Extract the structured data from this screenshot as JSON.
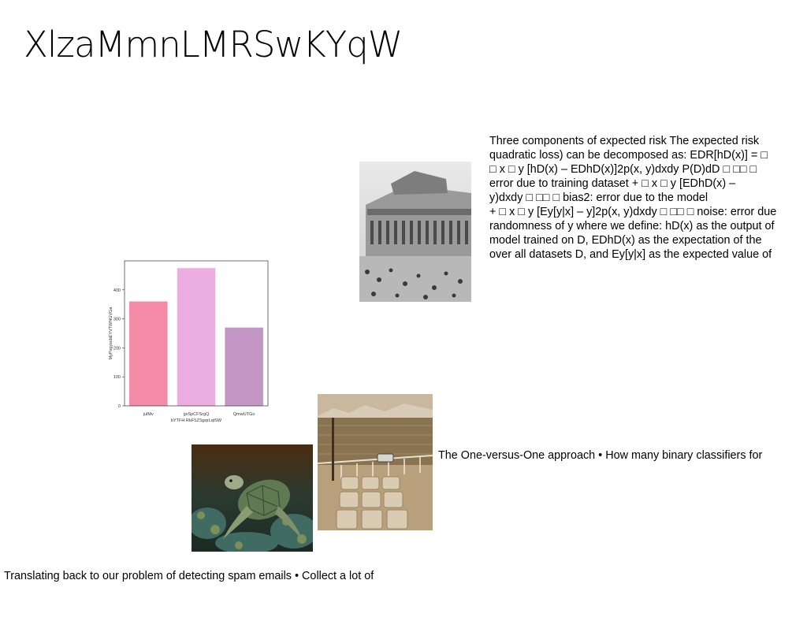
{
  "slide": {
    "title": "XlzaMmnLMRSwKYqW",
    "paragraph_lines": [
      "Three components of expected risk The expected risk",
      "quadratic loss) can be decomposed as: EDR[hD(x)] = □",
      "□ x □ y [hD(x) – EDhD(x)]2p(x, y)dxdy P(D)dD □ □□ □",
      "error due to training dataset + □ x □ y [EDhD(x) –",
      "y)dxdy □ □□ □ bias2: error due to the model",
      "+ □ x □ y [Ey[y|x] – y]2p(x, y)dxdy □ □□ □ noise: error due",
      "randomness of y where we define: hD(x) as the output of",
      "model trained on D, EDhD(x) as the expectation of the",
      "over all datasets D, and Ey[y|x] as the expected value of"
    ],
    "caption_1": "The One-versus-One approach • How many binary classifiers for",
    "caption_2": "Translating back to our problem of detecting spam emails • Collect a lot of"
  },
  "chart_data": {
    "type": "bar",
    "categories": [
      "julMv",
      "gxSpCFSrgQ",
      "QmwUTGo"
    ],
    "values": [
      360,
      475,
      270
    ],
    "colors": [
      "#f48aa6",
      "#ecaee0",
      "#c496c6"
    ],
    "xlabel": "bYTFH RkFSZSgqrLqtSW",
    "ylabel": "MyPxgysxbEYVTWNGVGa",
    "ylim": [
      0,
      500
    ],
    "yticks": [
      0,
      100,
      200,
      300,
      400
    ],
    "grid": false
  }
}
